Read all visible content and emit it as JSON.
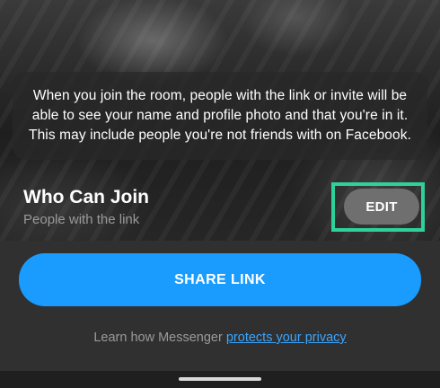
{
  "room_info": {
    "line1": "When you join the room, people with the link or invite will be",
    "line2": "able to see your name and profile photo and that you're in it.",
    "line3": "This may include people you're not friends with on Facebook."
  },
  "who_can_join": {
    "title": "Who Can Join",
    "subtitle": "People with the link",
    "edit_label": "EDIT"
  },
  "share": {
    "label": "SHARE LINK"
  },
  "privacy": {
    "prefix": "Learn how Messenger ",
    "link_text": "protects your privacy"
  },
  "colors": {
    "share_button": "#1a9cff",
    "edit_highlight": "#2ed19a",
    "link": "#3ba5ff"
  }
}
